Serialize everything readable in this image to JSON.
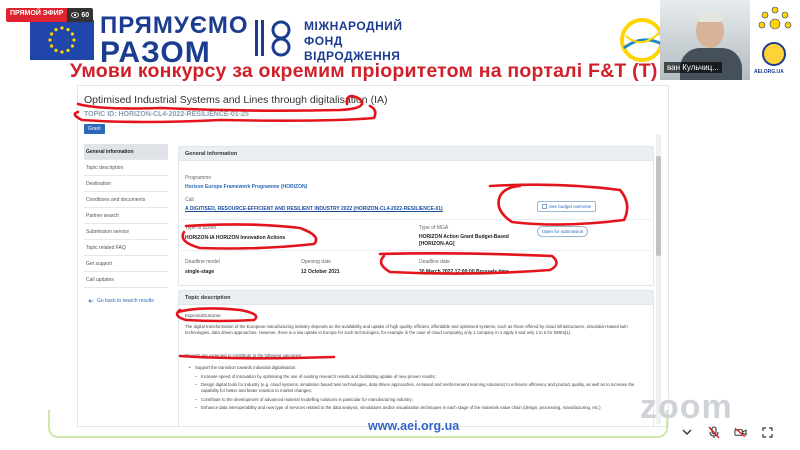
{
  "live_badge": {
    "label": "ПРЯМОЙ ЭФИР",
    "viewers": "60"
  },
  "logo": {
    "line1": "ПРЯМУЄМО",
    "line2": "РАЗОМ"
  },
  "foundation": {
    "line1": "МІЖНАРОДНИЙ",
    "line2": "ФОНД",
    "line3": "ВІДРОДЖЕННЯ"
  },
  "headline": "Умови конкурсу за окремим пріоритетом на порталі F&T (Т)",
  "video": {
    "participant_name": "ван Кульчиц..."
  },
  "horizon_panel": {
    "label": "AEI.ORG.UA"
  },
  "portal": {
    "topic_title": "Optimised Industrial Systems and Lines through digitalisation (IA)",
    "topic_id": "TOPIC ID: HORIZON-CL4-2022-RESILIENCE-01-25",
    "grant_button": "Grant",
    "menu": [
      "General information",
      "Topic description",
      "Destination",
      "Conditions and documents",
      "Partner search",
      "Submission service",
      "Topic related FAQ",
      "Get support",
      "Call updates"
    ],
    "back_link": "Go back to search results",
    "general": {
      "heading": "General information",
      "programme_label": "Programme",
      "programme_value": "Horizon Europe Framework Programme (HORIZON)",
      "call_label": "Call",
      "call_value": "A DIGITISED, RESOURCE-EFFICIENT AND RESILIENT INDUSTRY 2022 (HORIZON-CL4-2022-RESILIENCE-01)",
      "budget_button": "See budget overview",
      "type_action_label": "Type of action",
      "type_action_value": "HORIZON-IA HORIZON Innovation Actions",
      "type_mga_label": "Type of MGA",
      "type_mga_value_1": "HORIZON Action Grant Budget-Based",
      "type_mga_value_2": "[HORIZON-AG]",
      "submission_button": "Open for submission",
      "deadline_model_label": "Deadline model",
      "deadline_model_value": "single-stage",
      "opening_label": "Opening date",
      "opening_value": "12 October 2021",
      "deadline_label": "Deadline date",
      "deadline_value": "30 March 2022 17:00:00 Brussels time"
    },
    "description": {
      "heading": "Topic description",
      "expected_label": "ExpectedOutcome:",
      "paragraph": "The digital transformation of the European manufacturing industry depends on the availability and uptake of high quality, efficient, affordable and optimised systems, such as those offered by cloud infrastructures, simulation-based twin technologies, data driven approaches. However, there is a low uptake in Europe for such technologies, for example in the case of cloud computing only 1 company in 4 apply it and only 1 in 5 for SMEs[1].",
      "projects_label": "Projects are expected to contribute to the following outcomes:",
      "bullets": [
        "Support the transition towards industrial digitalisation:",
        "Increase speed of innovation by optimising the use of existing research results and facilitating uptake of new proven results;",
        "Design digital tools for industry (e.g. cloud systems, simulation based twin technologies, data driven approaches, AI-based and reinforcement learning solutions) to enhance efficiency and product quality, as well as to increase the capability for better and faster reaction to market changes;",
        "Contribute to the development of advanced material modelling solutions in particular for manufacturing industry;",
        "Enhance data interoperability and new type of services related to the data analysis, simulations and/or visualisation techniques in each stage of the materials value chain (design, processing, manufacturing, etc.)"
      ]
    }
  },
  "site_url": "www.aei.org.ua",
  "watermark": "zoom",
  "colors": {
    "headline_red": "#d0202a",
    "logo_blue": "#1b3c8f",
    "annotation_red": "#e3141b",
    "link_blue": "#2c68b8"
  }
}
